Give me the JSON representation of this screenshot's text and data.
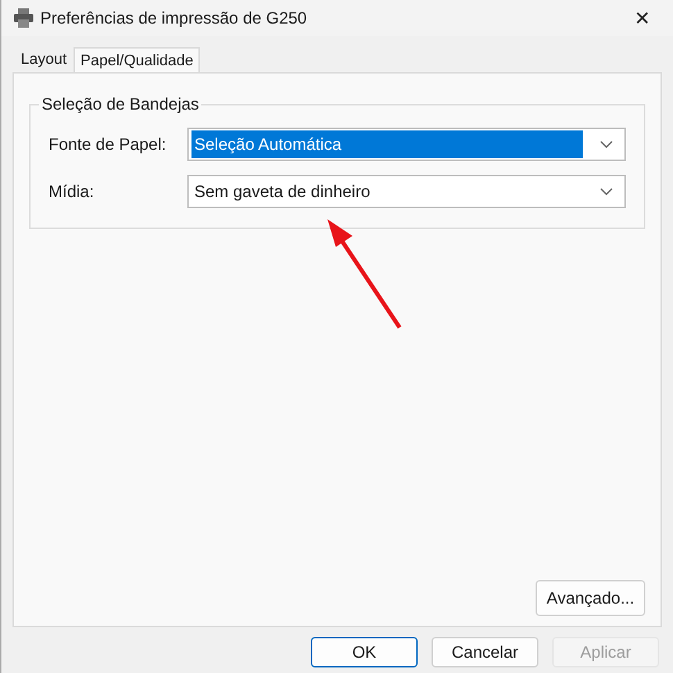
{
  "window": {
    "title": "Preferências de impressão de G250",
    "close": "✕"
  },
  "tabs": [
    {
      "label": "Layout",
      "selected": false
    },
    {
      "label": "Papel/Qualidade",
      "selected": true
    }
  ],
  "group": {
    "title": "Seleção de Bandejas",
    "fields": [
      {
        "label": "Fonte de Papel:",
        "value": "Seleção Automática",
        "highlighted": true
      },
      {
        "label": "Mídia:",
        "value": "Sem gaveta de dinheiro",
        "highlighted": false
      }
    ]
  },
  "advanced_button": "Avançado...",
  "buttons": [
    {
      "label": "OK",
      "default": true,
      "disabled": false
    },
    {
      "label": "Cancelar",
      "default": false,
      "disabled": false
    },
    {
      "label": "Aplicar",
      "default": false,
      "disabled": true
    }
  ]
}
